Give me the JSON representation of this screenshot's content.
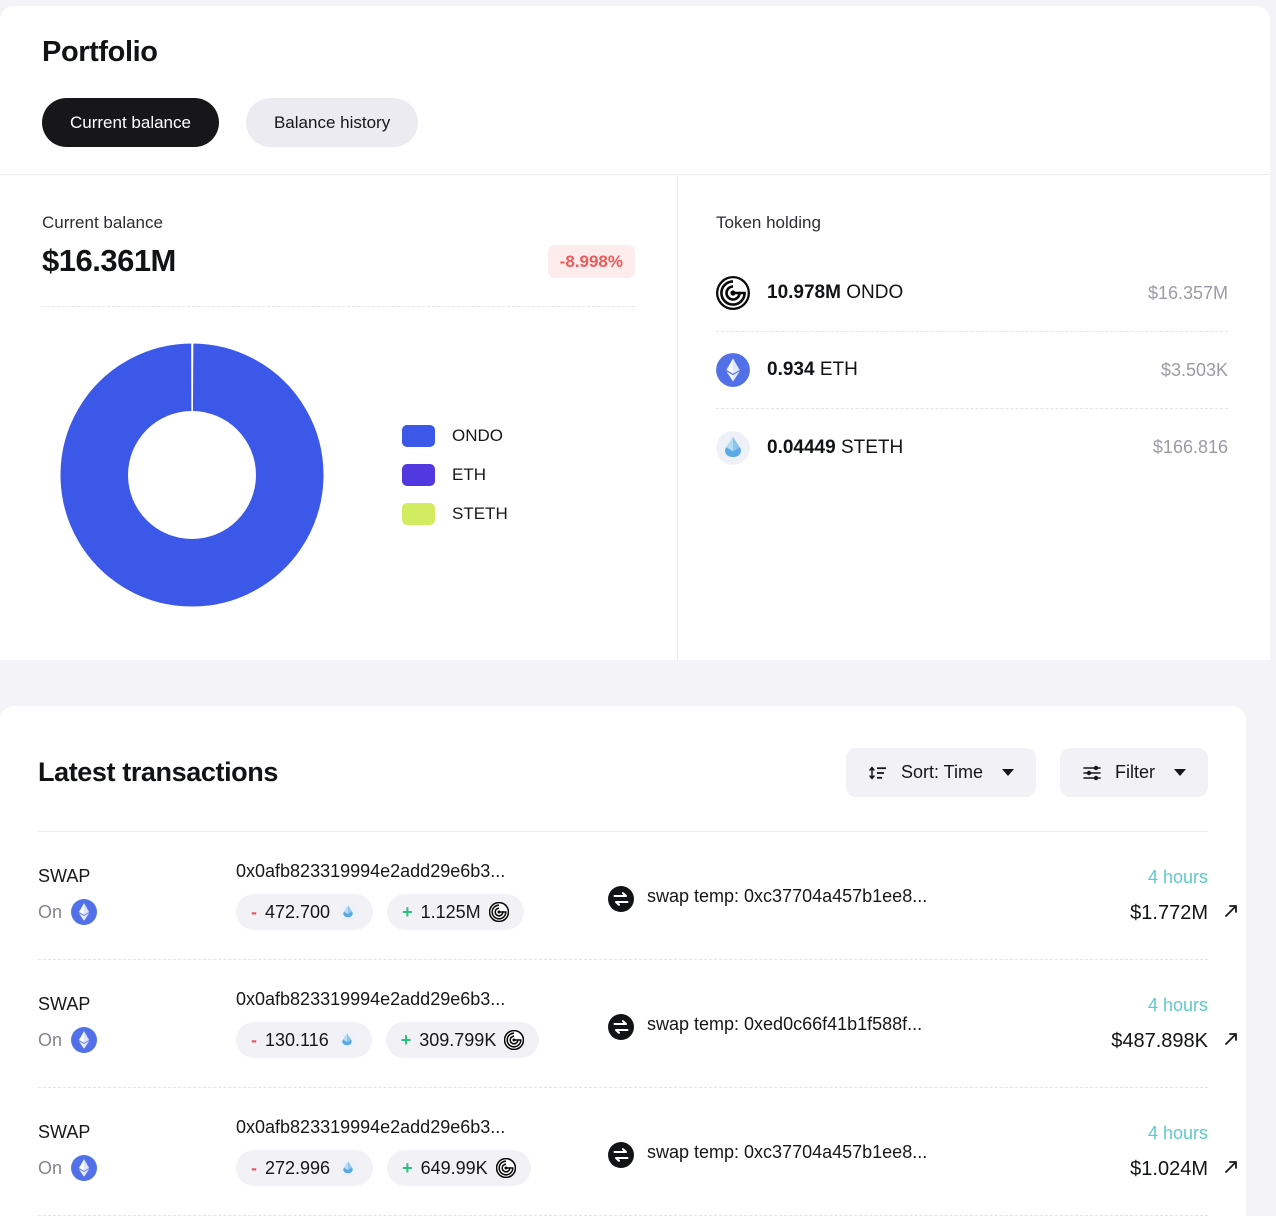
{
  "header": {
    "title": "Portfolio",
    "tabs": [
      {
        "label": "Current balance",
        "active": true
      },
      {
        "label": "Balance history",
        "active": false
      }
    ]
  },
  "balance_panel": {
    "label": "Current balance",
    "value": "$16.361M",
    "delta": "-8.998%",
    "delta_color": "#ec5b5b",
    "delta_bg": "#fdecec"
  },
  "chart_data": {
    "type": "pie",
    "title": "Current balance",
    "categories": [
      "ONDO",
      "ETH",
      "STETH"
    ],
    "values": [
      16357000,
      3503,
      166.816
    ],
    "percentages": [
      99.9776,
      0.0214,
      0.001
    ],
    "colors": [
      "#3c58e8",
      "#5139e0",
      "#d2ec61"
    ],
    "legend_position": "right",
    "donut": true,
    "inner_radius_ratio": 0.45,
    "xlabel": "",
    "ylabel": ""
  },
  "legend": [
    {
      "label": "ONDO",
      "color": "#3c58e8"
    },
    {
      "label": "ETH",
      "color": "#5139e0"
    },
    {
      "label": "STETH",
      "color": "#d2ec61"
    }
  ],
  "token_holding": {
    "title": "Token holding",
    "rows": [
      {
        "icon": "ondo-token-icon",
        "amount": "10.978M",
        "symbol": "ONDO",
        "usd": "$16.357M"
      },
      {
        "icon": "eth-token-icon",
        "amount": "0.934",
        "symbol": "ETH",
        "usd": "$3.503K"
      },
      {
        "icon": "steth-token-icon",
        "amount": "0.04449",
        "symbol": "STETH",
        "usd": "$166.816"
      }
    ]
  },
  "transactions": {
    "title": "Latest transactions",
    "sort_label": "Sort: Time",
    "filter_label": "Filter",
    "rows": [
      {
        "type": "SWAP",
        "on_label": "On",
        "on_chain_icon": "eth-chain-icon",
        "hash": "0x0afb823319994e2add29e6b3...",
        "out_sign": "-",
        "out_amount": "472.700",
        "out_token_icon": "steth-token-icon",
        "in_sign": "+",
        "in_amount": "1.125M",
        "in_token_icon": "ondo-token-icon",
        "to_label": "swap temp: 0xc37704a457b1ee8...",
        "time": "4 hours",
        "usd": "$1.772M"
      },
      {
        "type": "SWAP",
        "on_label": "On",
        "on_chain_icon": "eth-chain-icon",
        "hash": "0x0afb823319994e2add29e6b3...",
        "out_sign": "-",
        "out_amount": "130.116",
        "out_token_icon": "steth-token-icon",
        "in_sign": "+",
        "in_amount": "309.799K",
        "in_token_icon": "ondo-token-icon",
        "to_label": "swap temp: 0xed0c66f41b1f588f...",
        "time": "4 hours",
        "usd": "$487.898K"
      },
      {
        "type": "SWAP",
        "on_label": "On",
        "on_chain_icon": "eth-chain-icon",
        "hash": "0x0afb823319994e2add29e6b3...",
        "out_sign": "-",
        "out_amount": "272.996",
        "out_token_icon": "steth-token-icon",
        "in_sign": "+",
        "in_amount": "649.99K",
        "in_token_icon": "ondo-token-icon",
        "to_label": "swap temp: 0xc37704a457b1ee8...",
        "time": "4 hours",
        "usd": "$1.024M"
      }
    ]
  }
}
